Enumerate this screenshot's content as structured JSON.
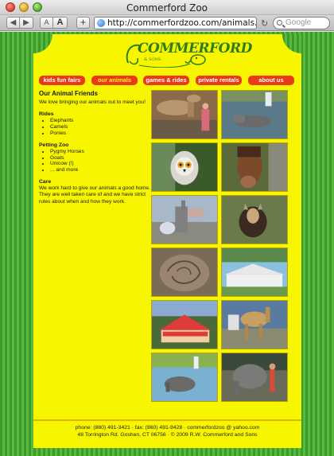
{
  "browser": {
    "window_title": "Commerford Zoo",
    "url": "http://commerfordzoo.com/animals.php",
    "search_placeholder": "Google",
    "text_small_label": "A",
    "text_big_label": "A",
    "add_label": "+"
  },
  "logo": {
    "name": "COMMERFORD",
    "sub": "& SONS"
  },
  "nav": [
    {
      "label": "kids fun fairs",
      "active": false
    },
    {
      "label": "our animals",
      "active": true
    },
    {
      "label": "games & rides",
      "active": false
    },
    {
      "label": "private rentals",
      "active": false
    },
    {
      "label": "about us",
      "active": false
    }
  ],
  "content": {
    "title": "Our Animal Friends",
    "intro": "We love bringing our animals out to meet you!",
    "rides_heading": "Rides",
    "rides": [
      "Elephants",
      "Camels",
      "Ponies"
    ],
    "petting_heading": "Petting Zoo",
    "petting": [
      "Pygmy Horses",
      "Goats",
      "Unicow (!)",
      "... and more"
    ],
    "care_heading": "Care",
    "care_text": "We work hard to give our animals a good home. They are well taken care of and we have strict rules about when and how they work."
  },
  "footer": {
    "line1": "phone: (860) 491-3421   ·   fax: (860) 491-9428   ·   commerfordzoo @ yahoo.com",
    "line2": "48 Torrington Rd. Goshen, CT 06756   ·   © 2009 R.W. Commerford and Sons"
  },
  "colors": {
    "page": "#f8f500",
    "nav": "#e83a16",
    "stripe_dark": "#3a9b2a",
    "stripe_light": "#58b840",
    "logo": "#2e7d1a"
  }
}
